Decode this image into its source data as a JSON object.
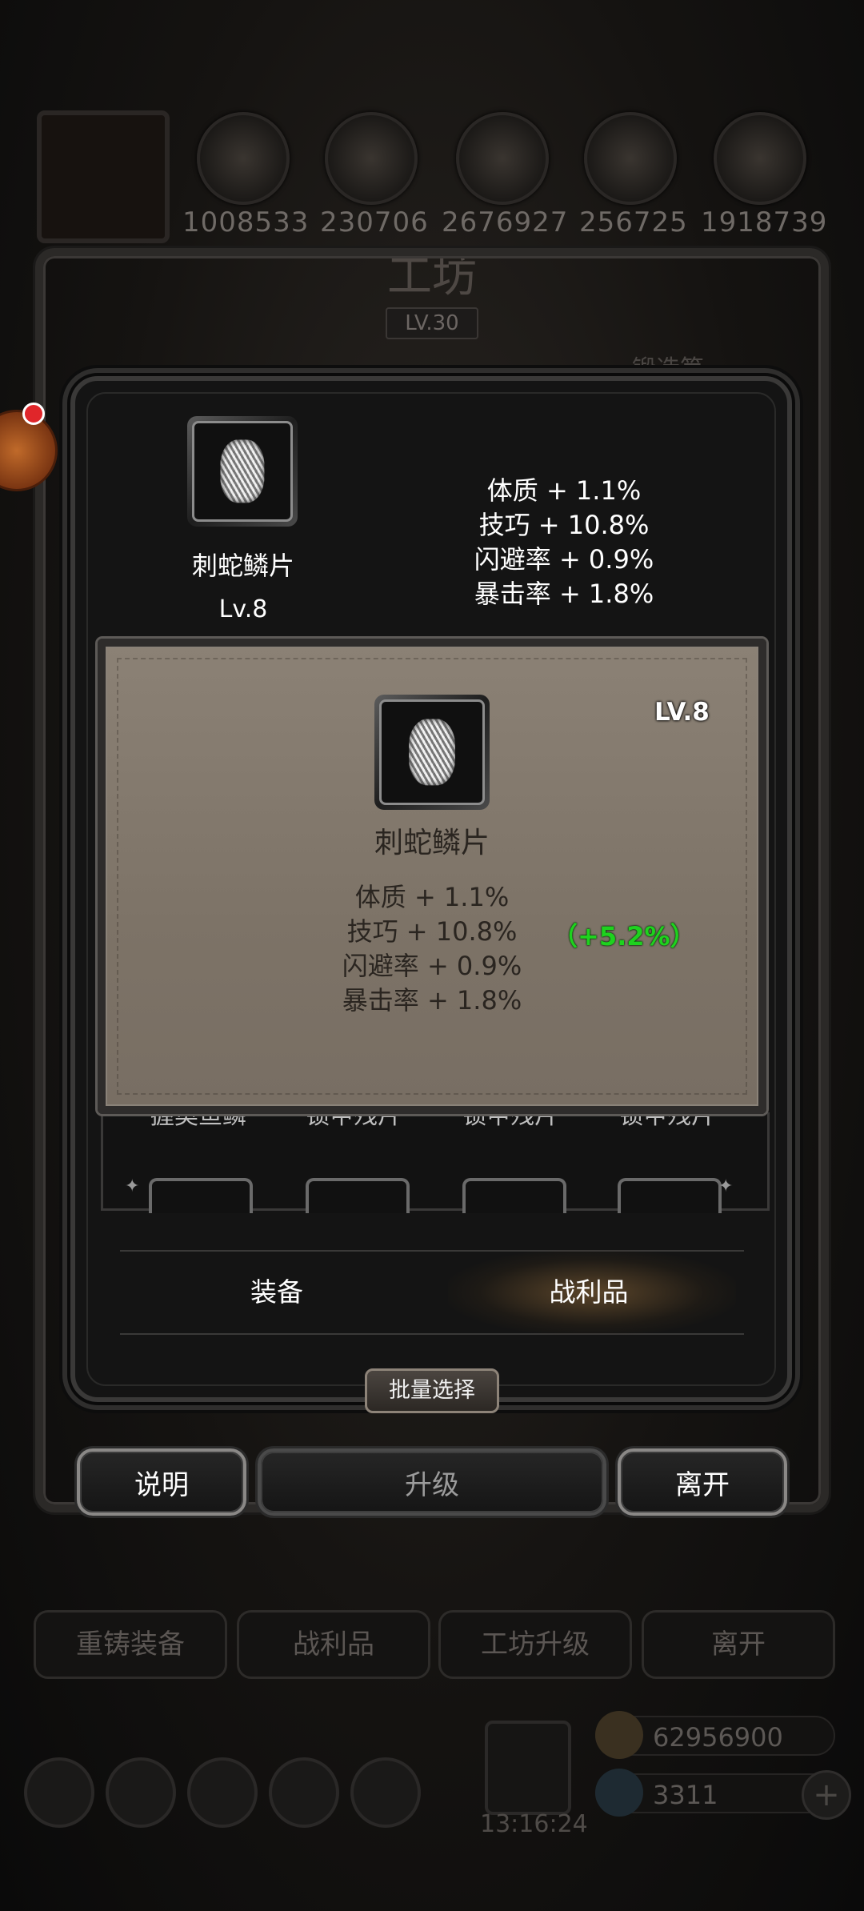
{
  "resources": {
    "values": [
      "1008533",
      "230706",
      "2676927",
      "256725",
      "1918739"
    ]
  },
  "workshop": {
    "title": "工坊",
    "level": "LV.30",
    "side_tab": "锻造笋"
  },
  "item": {
    "name": "刺蛇鳞片",
    "level": "Lv.8",
    "stats": [
      "体质 + 1.1%",
      "技巧 + 10.8%",
      "闪避率 + 0.9%",
      "暴击率 + 1.8%"
    ]
  },
  "tooltip": {
    "level": "LV.8",
    "name": "刺蛇鳞片",
    "stats": [
      "体质 + 1.1%",
      "技巧 + 10.8%",
      "闪避率 + 0.9%",
      "暴击率 + 1.8%"
    ],
    "bonus": "（+5.2%）",
    "bonus_color": "#1ed21e"
  },
  "list_labels": [
    "握奥鱼鳞",
    "锁甲残片",
    "锁甲残片",
    "锁甲残片"
  ],
  "tabs": {
    "equipment": "装备",
    "loot": "战利品"
  },
  "buttons": {
    "batch_select": "批量选择",
    "info": "说明",
    "upgrade": "升级",
    "leave": "离开"
  },
  "bottom_bar": {
    "reforge": "重铸装备",
    "loot": "战利品",
    "workshop_upgrade": "工坊升级",
    "leave": "离开"
  },
  "currency": {
    "gold": "62956900",
    "gems": "3311",
    "timer": "13:16:24"
  },
  "icons": [
    "chest-icon",
    "scale-armor-icon",
    "gold-coin-icon",
    "gem-icon",
    "plus-icon",
    "gift-box-icon"
  ]
}
